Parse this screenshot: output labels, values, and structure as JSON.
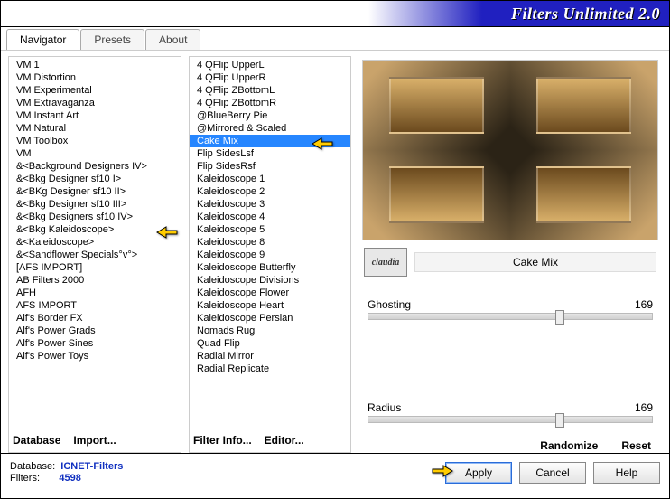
{
  "title": "Filters Unlimited 2.0",
  "tabs": [
    "Navigator",
    "Presets",
    "About"
  ],
  "activeTab": 0,
  "categories": [
    "VM 1",
    "VM Distortion",
    "VM Experimental",
    "VM Extravaganza",
    "VM Instant Art",
    "VM Natural",
    "VM Toolbox",
    "VM",
    "&<Background Designers IV>",
    "&<Bkg Designer sf10 I>",
    "&<BKg Designer sf10 II>",
    "&<Bkg Designer sf10 III>",
    "&<Bkg Designers sf10 IV>",
    "&<Bkg Kaleidoscope>",
    "&<Kaleidoscope>",
    "&<Sandflower Specials°v°>",
    "[AFS IMPORT]",
    "AB Filters 2000",
    "AFH",
    "AFS IMPORT",
    "Alf's Border FX",
    "Alf's Power Grads",
    "Alf's Power Sines",
    "Alf's Power Toys"
  ],
  "categoryPointerIndex": 13,
  "filters": [
    "4 QFlip UpperL",
    "4 QFlip UpperR",
    "4 QFlip ZBottomL",
    "4 QFlip ZBottomR",
    "@BlueBerry Pie",
    "@Mirrored & Scaled",
    "Cake Mix",
    "Flip SidesLsf",
    "Flip SidesRsf",
    "Kaleidoscope 1",
    "Kaleidoscope 2",
    "Kaleidoscope 3",
    "Kaleidoscope 4",
    "Kaleidoscope 5",
    "Kaleidoscope 8",
    "Kaleidoscope 9",
    "Kaleidoscope Butterfly",
    "Kaleidoscope Divisions",
    "Kaleidoscope Flower",
    "Kaleidoscope Heart",
    "Kaleidoscope Persian",
    "Nomads Rug",
    "Quad Flip",
    "Radial Mirror",
    "Radial Replicate"
  ],
  "selectedFilterIndex": 6,
  "catButtons": {
    "db": "Database",
    "imp": "Import..."
  },
  "filButtons": {
    "info": "Filter Info...",
    "ed": "Editor..."
  },
  "watermark": {
    "badge": "claudia",
    "label": "Cake Mix"
  },
  "params": [
    {
      "name": "Ghosting",
      "value": "169",
      "pos": 66
    },
    {
      "name": "Radius",
      "value": "169",
      "pos": 66
    }
  ],
  "rr": {
    "rand": "Randomize",
    "reset": "Reset"
  },
  "footer": {
    "dbLabel": "Database:",
    "dbVal": "ICNET-Filters",
    "filLabel": "Filters:",
    "filVal": "4598"
  },
  "buttons": {
    "apply": "Apply",
    "cancel": "Cancel",
    "help": "Help"
  }
}
